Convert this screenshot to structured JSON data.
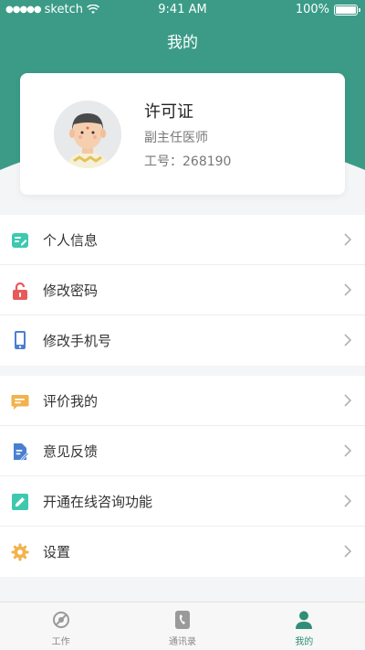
{
  "status_bar": {
    "carrier": "sketch",
    "time": "9:41 AM",
    "battery": "100%"
  },
  "header": {
    "title": "我的"
  },
  "profile": {
    "name": "许可证",
    "position": "副主任医师",
    "id_label": "工号：",
    "id_value": "268190"
  },
  "menu_group_1": [
    {
      "label": "个人信息",
      "icon": "id-card-icon",
      "color": "#3ec8b0"
    },
    {
      "label": "修改密码",
      "icon": "lock-icon",
      "color": "#e85a5a"
    },
    {
      "label": "修改手机号",
      "icon": "phone-icon",
      "color": "#4a7fd1"
    }
  ],
  "menu_group_2": [
    {
      "label": "评价我的",
      "icon": "comment-icon",
      "color": "#f2b24c"
    },
    {
      "label": "意见反馈",
      "icon": "feedback-icon",
      "color": "#4a7fd1"
    },
    {
      "label": "开通在线咨询功能",
      "icon": "edit-icon",
      "color": "#3ec8b0"
    },
    {
      "label": "设置",
      "icon": "gear-icon",
      "color": "#f2b24c"
    }
  ],
  "tab_bar": [
    {
      "label": "工作",
      "icon": "work-icon",
      "active": false
    },
    {
      "label": "通讯录",
      "icon": "contacts-icon",
      "active": false
    },
    {
      "label": "我的",
      "icon": "person-icon",
      "active": true
    }
  ],
  "colors": {
    "primary": "#3b9b87",
    "active_tab": "#2f8e78",
    "background": "#f4f5f7"
  }
}
